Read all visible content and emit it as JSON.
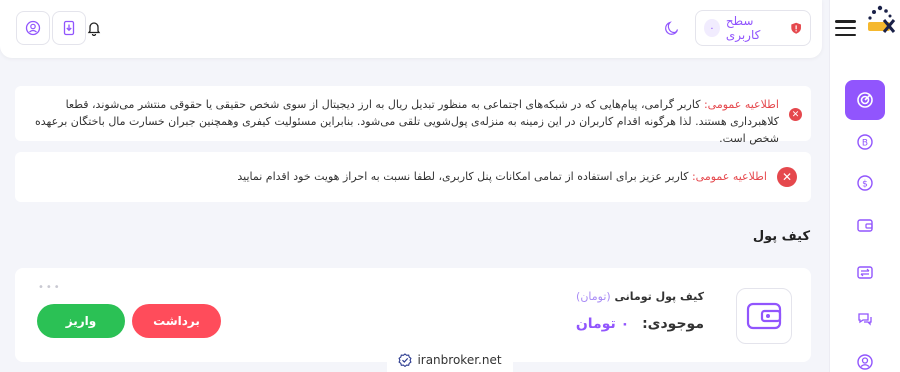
{
  "header": {
    "user_level_label": "سطح کاربری",
    "user_level_value": "۰"
  },
  "alerts": [
    {
      "title": "اطلاعیه عمومی:",
      "text": "کاربر گرامی، پیام‌هایی که در شبکه‌های اجتماعی به منظور تبدیل ریال به ارز دیجیتال از سوی شخص حقیقی یا حقوقی منتشر می‌شوند، قطعا کلاهبرداری هستند. لذا هرگونه اقدام کاربران در این زمینه به منزله‌ی پول‌شویی تلقی می‌شود. بنابراین مسئولیت کیفری وهمچنین جبران خسارت مال باختگان برعهده شخص است."
    },
    {
      "title": "اطلاعیه عمومی:",
      "text": "کاربر عزیز برای استفاده از تمامی امکانات پنل کاربری، لطفا نسبت به احراز هویت خود اقدام نمایید"
    }
  ],
  "wallet_section": {
    "title": "کیف پول",
    "wallet_name": "کیف پول تومانی",
    "wallet_unit": "(تومان)",
    "balance_label": "موجودی:",
    "balance_value": "۰ تومان",
    "withdraw_label": "برداشت",
    "deposit_label": "واریز",
    "more_dots": "•••"
  },
  "watermark": {
    "text": "iranbroker.net"
  },
  "colors": {
    "accent": "#9155fd",
    "danger": "#ff4c5b",
    "success": "#2bc155",
    "background": "#f4f5fa"
  },
  "icons": {
    "sidebar": [
      "dashboard-icon",
      "bitcoin-icon",
      "dollar-coin-icon",
      "wallet-icon",
      "exchange-icon",
      "chat-icon",
      "user-icon"
    ]
  }
}
